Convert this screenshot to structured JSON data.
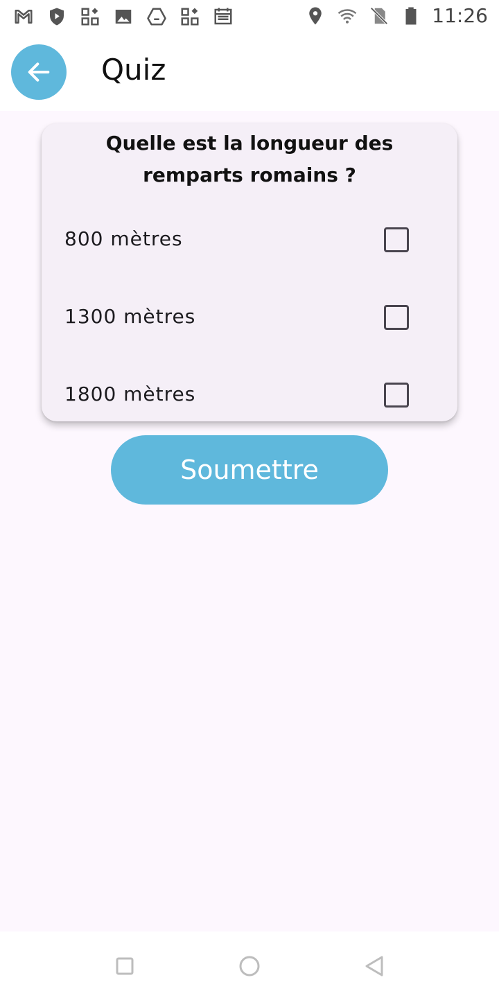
{
  "status_bar": {
    "time": "11:26",
    "left_icons": [
      "gmail-icon",
      "shield-play-icon",
      "apps-icon",
      "image-icon",
      "drive-icon",
      "apps-icon-2",
      "calendar-icon"
    ],
    "right_icons": [
      "location-icon",
      "wifi-icon",
      "no-sim-icon",
      "battery-icon"
    ]
  },
  "app_bar": {
    "title": "Quiz",
    "accent_color": "#5fb8dc"
  },
  "quiz": {
    "question": "Quelle est la longueur des remparts romains ?",
    "options": [
      {
        "label": "800 mètres",
        "checked": false
      },
      {
        "label": "1300 mètres",
        "checked": false
      },
      {
        "label": "1800 mètres",
        "checked": false
      }
    ],
    "submit_label": "Soumettre"
  },
  "nav_bar": {
    "icons": [
      "recents-square-icon",
      "home-circle-icon",
      "back-triangle-icon"
    ]
  }
}
